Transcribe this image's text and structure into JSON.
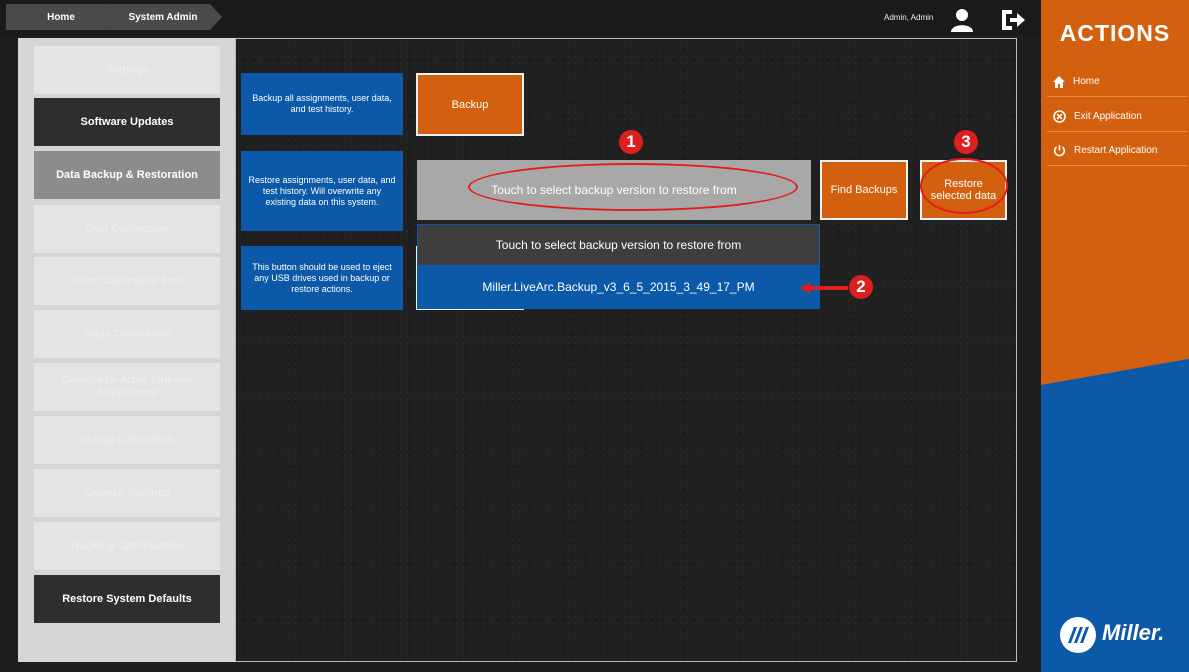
{
  "header": {
    "breadcrumbs": [
      "Home",
      "System Admin"
    ],
    "user_name": "Admin, Admin"
  },
  "sidebar": {
    "items": [
      {
        "label": "Settings",
        "state": "disabled"
      },
      {
        "label": "Software Updates",
        "state": "enabled"
      },
      {
        "label": "Data Backup & Restoration",
        "state": "active"
      },
      {
        "label": "Gun Calibration",
        "state": "disabled"
      },
      {
        "label": "Joint Calibration Tool",
        "state": "disabled"
      },
      {
        "label": "Table Calibration",
        "state": "disabled"
      },
      {
        "label": "Camera-to-Arms Linkage Adjustment",
        "state": "disabled"
      },
      {
        "label": "Clamp Calibration",
        "state": "disabled"
      },
      {
        "label": "Camera Settings",
        "state": "disabled"
      },
      {
        "label": "Tracking Optimization",
        "state": "disabled"
      },
      {
        "label": "Restore System Defaults",
        "state": "enabled"
      }
    ]
  },
  "main": {
    "backup_desc": "Backup all assignments, user data, and test history.",
    "backup_button": "Backup",
    "restore_desc": "Restore assignments, user data, and test history.  Will overwrite any existing data on this system.",
    "select_placeholder": "Touch to select backup version to restore from",
    "find_backups_button": "Find Backups",
    "restore_button": "Restore selected data",
    "eject_desc": "This button should be used to eject any USB drives used in backup or restore actions.",
    "dropdown": {
      "header": "Touch to select backup version to restore from",
      "options": [
        "Miller.LiveArc.Backup_v3_6_5_2015_3_49_17_PM"
      ]
    },
    "annotations": [
      "1",
      "2",
      "3"
    ]
  },
  "actions": {
    "title": "ACTIONS",
    "items": [
      {
        "label": "Home",
        "icon": "home-icon"
      },
      {
        "label": "Exit Application",
        "icon": "close-circle-icon"
      },
      {
        "label": "Restart Application",
        "icon": "power-icon"
      }
    ],
    "logo_text": "Miller."
  },
  "colors": {
    "accent_orange": "#d3600e",
    "accent_blue": "#0c58a9",
    "annotation_red": "#dd1f1f"
  }
}
